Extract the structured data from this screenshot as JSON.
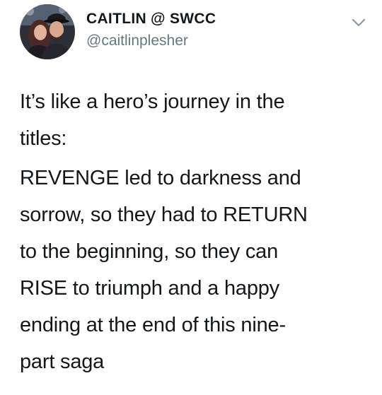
{
  "author": {
    "display_name": "CAITLIN @ SWCC",
    "handle": "@caitlinplesher",
    "avatar_icon": "profile-photo-icon",
    "menu_icon": "chevron-down-icon"
  },
  "tweet": {
    "paragraphs": [
      "It’s like a hero’s journey in the\ntitles:",
      "REVENGE led to darkness and\nsorrow, so they had to RETURN\nto the beginning, so they can\nRISE to triumph and a happy\nending at the end of this nine-\npart saga"
    ]
  },
  "colors": {
    "text": "#14171a",
    "handle": "#657786",
    "background": "#ffffff"
  }
}
